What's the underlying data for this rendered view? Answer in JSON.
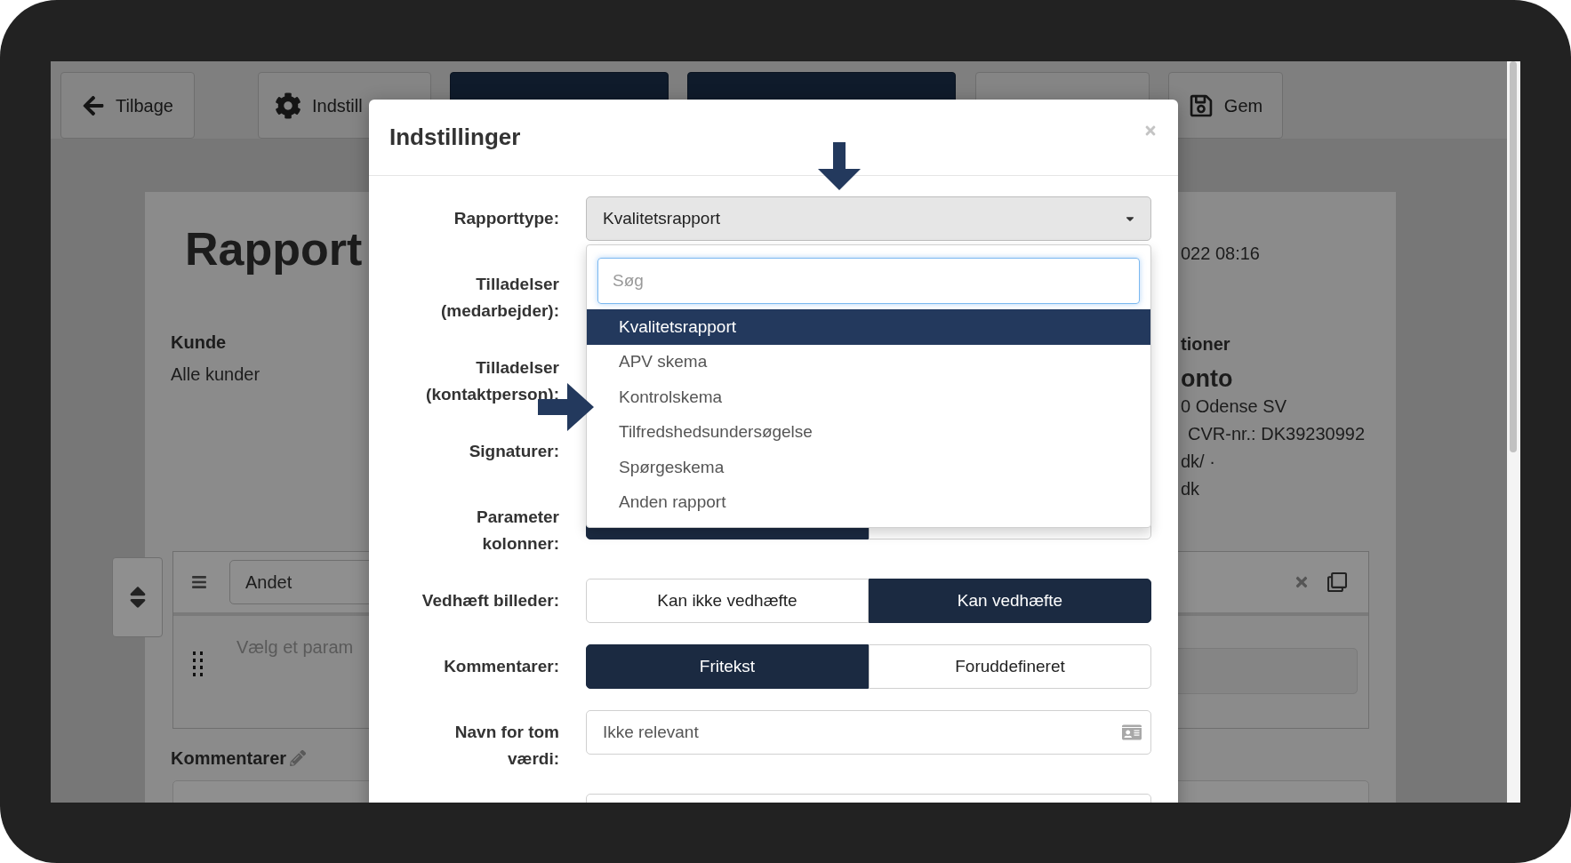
{
  "toolbar": {
    "buttons": [
      {
        "kind": "back",
        "label": "Tilbage"
      },
      {
        "kind": "settings",
        "label": "Indstill"
      },
      {
        "kind": "dark"
      },
      {
        "kind": "dark"
      },
      {
        "kind": "view"
      },
      {
        "kind": "save",
        "label": "Gem"
      }
    ]
  },
  "report": {
    "title": "Rapport",
    "customer_label": "Kunde",
    "customer_value": "Alle kunder",
    "date": "022 08:16",
    "info_heading": "tioner",
    "company": "onto",
    "info_lines": [
      "0 Odense SV",
      "CVR-nr.: DK39230992",
      "dk/ ·",
      "dk"
    ],
    "parameter": {
      "category": "Andet",
      "placeholder": "Vælg et param"
    },
    "comments_label": "Kommentarer"
  },
  "modal": {
    "title": "Indstillinger",
    "rows": [
      {
        "kind": "select",
        "label": "Rapporttype:",
        "value": "Kvalitetsrapport",
        "expanded": true,
        "search_placeholder": "Søg",
        "options": [
          {
            "label": "Kvalitetsrapport",
            "selected": true
          },
          {
            "label": "APV skema",
            "selected": false
          },
          {
            "label": "Kontrolskema",
            "selected": false
          },
          {
            "label": "Tilfredshedsundersøgelse",
            "selected": false
          },
          {
            "label": "Spørgeskema",
            "selected": false
          },
          {
            "label": "Anden rapport",
            "selected": false
          }
        ]
      },
      {
        "kind": "covered",
        "label": [
          "Tilladelser",
          "(medarbejder):"
        ]
      },
      {
        "kind": "covered",
        "label": [
          "Tilladelser",
          "(kontaktperson):"
        ]
      },
      {
        "kind": "covered",
        "label": [
          "Signaturer:"
        ]
      },
      {
        "kind": "segmented",
        "label": [
          "Parameter",
          "kolonner:"
        ],
        "options": [
          {
            "selected": true
          },
          {
            "selected": false
          }
        ]
      },
      {
        "kind": "segmented",
        "label": [
          "Vedhæft billeder:"
        ],
        "options": [
          {
            "label": "Kan ikke vedhæfte",
            "selected": false
          },
          {
            "label": "Kan vedhæfte",
            "selected": true
          }
        ]
      },
      {
        "kind": "segmented",
        "label": [
          "Kommentarer:"
        ],
        "options": [
          {
            "label": "Fritekst",
            "selected": true
          },
          {
            "label": "Foruddefineret",
            "selected": false
          }
        ]
      },
      {
        "kind": "text",
        "label": [
          "Navn for tom",
          "værdi:"
        ],
        "value": "Ikke relevant"
      },
      {
        "kind": "text"
      }
    ]
  },
  "annotations": [
    {
      "kind": "arrow-down"
    },
    {
      "kind": "arrow-right"
    }
  ]
}
